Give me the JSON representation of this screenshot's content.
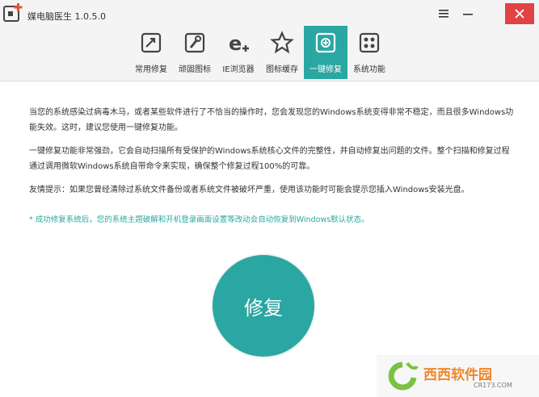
{
  "app": {
    "title": "媒电脑医生 1.0.5.0",
    "logo_icon": "app-logo-icon"
  },
  "window_controls": {
    "menu_icon": "menu-icon",
    "minimize_icon": "minimize-icon",
    "close_icon": "close-icon",
    "close_color": "#e04343"
  },
  "tabs": [
    {
      "label": "常用修复",
      "icon": "common-repair-icon",
      "active": false
    },
    {
      "label": "顽固图标",
      "icon": "stubborn-icon-tool-icon",
      "active": false
    },
    {
      "label": "IE浏览器",
      "icon": "ie-browser-icon",
      "active": false
    },
    {
      "label": "图标缓存",
      "icon": "icon-cache-icon",
      "active": false
    },
    {
      "label": "一键修复",
      "icon": "one-click-repair-icon",
      "active": true
    },
    {
      "label": "系统功能",
      "icon": "system-function-icon",
      "active": false
    }
  ],
  "content": {
    "paragraph1": "当您的系统感染过病毒木马，或者某些软件进行了不恰当的操作时，您会发现您的Windows系统变得非常不稳定，而且很多Windows功能失效。这时，建议您使用一键修复功能。",
    "paragraph2": "一键修复功能非常强劲，它会自动扫描所有受保护的Windows系统核心文件的完整性，并自动修复出问题的文件。整个扫描和修复过程通过调用微软Windows系统自带命令来实现，确保整个修复过程100%的可靠。",
    "paragraph3": "友情提示：如果您曾经清除过系统文件备份或者系统文件被破坏严重，使用该功能时可能会提示您插入Windows安装光盘。",
    "note": "* 成功修复系统后，您的系统主题破解和开机登录画面设置等改动会自动恢复到Windows默认状态。"
  },
  "repair_button": {
    "label": "修复",
    "color": "#2aa7a2"
  },
  "watermark": {
    "text": "西西软件园",
    "sub": "CR173.COM"
  }
}
